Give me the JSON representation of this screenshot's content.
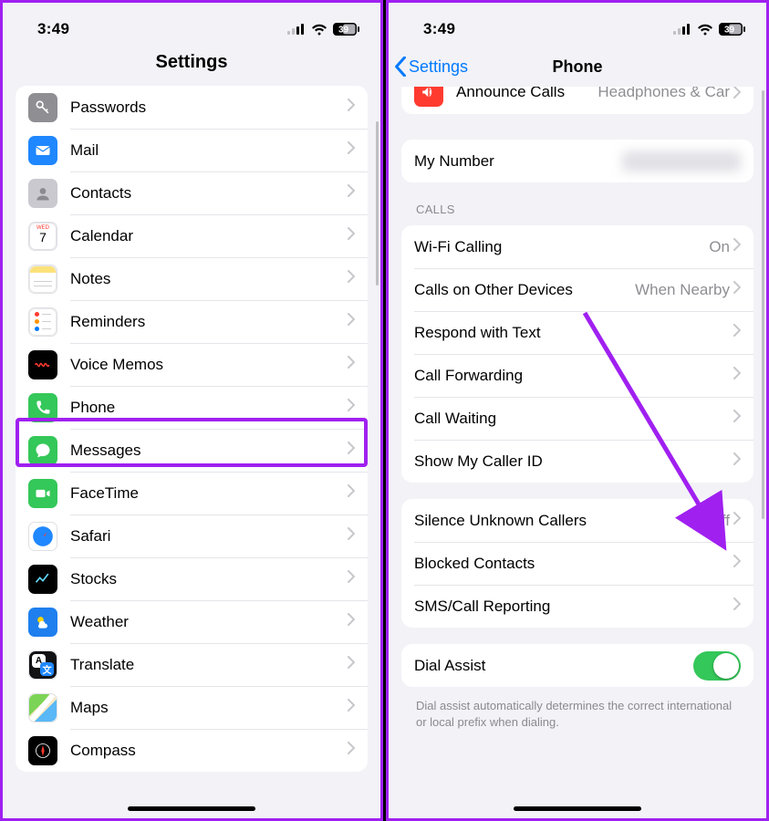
{
  "status": {
    "time": "3:49",
    "battery": "39"
  },
  "left": {
    "title": "Settings",
    "items": [
      {
        "label": "Passwords",
        "icon": "key",
        "bg": "#8e8e93"
      },
      {
        "label": "Mail",
        "icon": "mail",
        "bg": "#1f87ff"
      },
      {
        "label": "Contacts",
        "icon": "contact",
        "bg": "#c9c9cf"
      },
      {
        "label": "Calendar",
        "icon": "calendar",
        "bg": "#ffffff"
      },
      {
        "label": "Notes",
        "icon": "notes",
        "bg": "#ffffff"
      },
      {
        "label": "Reminders",
        "icon": "reminders",
        "bg": "#ffffff"
      },
      {
        "label": "Voice Memos",
        "icon": "voicememos",
        "bg": "#000000"
      },
      {
        "label": "Phone",
        "icon": "phone",
        "bg": "#34c759"
      },
      {
        "label": "Messages",
        "icon": "messages",
        "bg": "#34c759"
      },
      {
        "label": "FaceTime",
        "icon": "facetime",
        "bg": "#34c759"
      },
      {
        "label": "Safari",
        "icon": "safari",
        "bg": "#ffffff"
      },
      {
        "label": "Stocks",
        "icon": "stocks",
        "bg": "#000000"
      },
      {
        "label": "Weather",
        "icon": "weather",
        "bg": "#1f7fee"
      },
      {
        "label": "Translate",
        "icon": "translate",
        "bg": "#ffffff"
      },
      {
        "label": "Maps",
        "icon": "maps",
        "bg": "#ffffff"
      },
      {
        "label": "Compass",
        "icon": "compass",
        "bg": "#000000"
      }
    ]
  },
  "right": {
    "back": "Settings",
    "title": "Phone",
    "announce": {
      "label": "Announce Calls",
      "value": "Headphones & Car"
    },
    "my_number": {
      "label": "My Number"
    },
    "calls_header": "CALLS",
    "calls": [
      {
        "label": "Wi‑Fi Calling",
        "value": "On"
      },
      {
        "label": "Calls on Other Devices",
        "value": "When Nearby"
      },
      {
        "label": "Respond with Text",
        "value": ""
      },
      {
        "label": "Call Forwarding",
        "value": ""
      },
      {
        "label": "Call Waiting",
        "value": ""
      },
      {
        "label": "Show My Caller ID",
        "value": ""
      }
    ],
    "silence_group": [
      {
        "label": "Silence Unknown Callers",
        "value": "Off"
      },
      {
        "label": "Blocked Contacts",
        "value": ""
      },
      {
        "label": "SMS/Call Reporting",
        "value": ""
      }
    ],
    "dial_assist": {
      "label": "Dial Assist",
      "footer": "Dial assist automatically determines the correct international or local prefix when dialing."
    }
  }
}
